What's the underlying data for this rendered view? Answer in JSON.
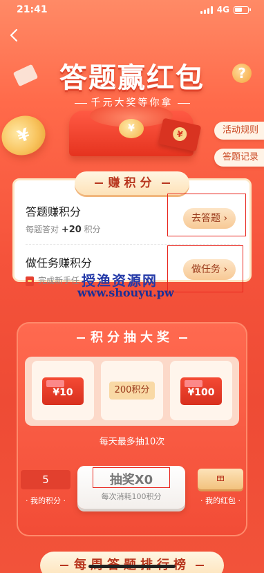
{
  "status_bar": {
    "time": "21:41",
    "network": "4G"
  },
  "hero": {
    "title": "答题赢红包",
    "subtitle": "千元大奖等你拿",
    "coin_symbol": "¥"
  },
  "side_buttons": {
    "rules": "活动规则",
    "records": "答题记录"
  },
  "earn_section": {
    "label": "赚积分",
    "quiz": {
      "title": "答题赚积分",
      "sub_prefix": "每题答对",
      "sub_value": "+20",
      "sub_suffix": "积分",
      "button": "去答题"
    },
    "tasks": {
      "title": "做任务赚积分",
      "sub": "完成新手任",
      "button": "做任务"
    }
  },
  "watermark": {
    "cn": "授渔资源网",
    "url": "www.shouyu.pw"
  },
  "lottery": {
    "label": "积分抽大奖",
    "prizes": [
      {
        "label": "¥10"
      },
      {
        "label": "200积分"
      },
      {
        "label": "¥100"
      }
    ],
    "daily_note": "每天最多抽10次",
    "my_points_value": "5",
    "my_points_label": "我的积分",
    "draw_button": "抽奖X0",
    "draw_cost": "每次消耗100积分",
    "my_redpack_label": "我的红包"
  },
  "weekly_rank_label": "每周答题排行榜",
  "colors": {
    "accent": "#f2533a",
    "highlight_box": "#e8241c",
    "cream": "#fde2b8"
  }
}
